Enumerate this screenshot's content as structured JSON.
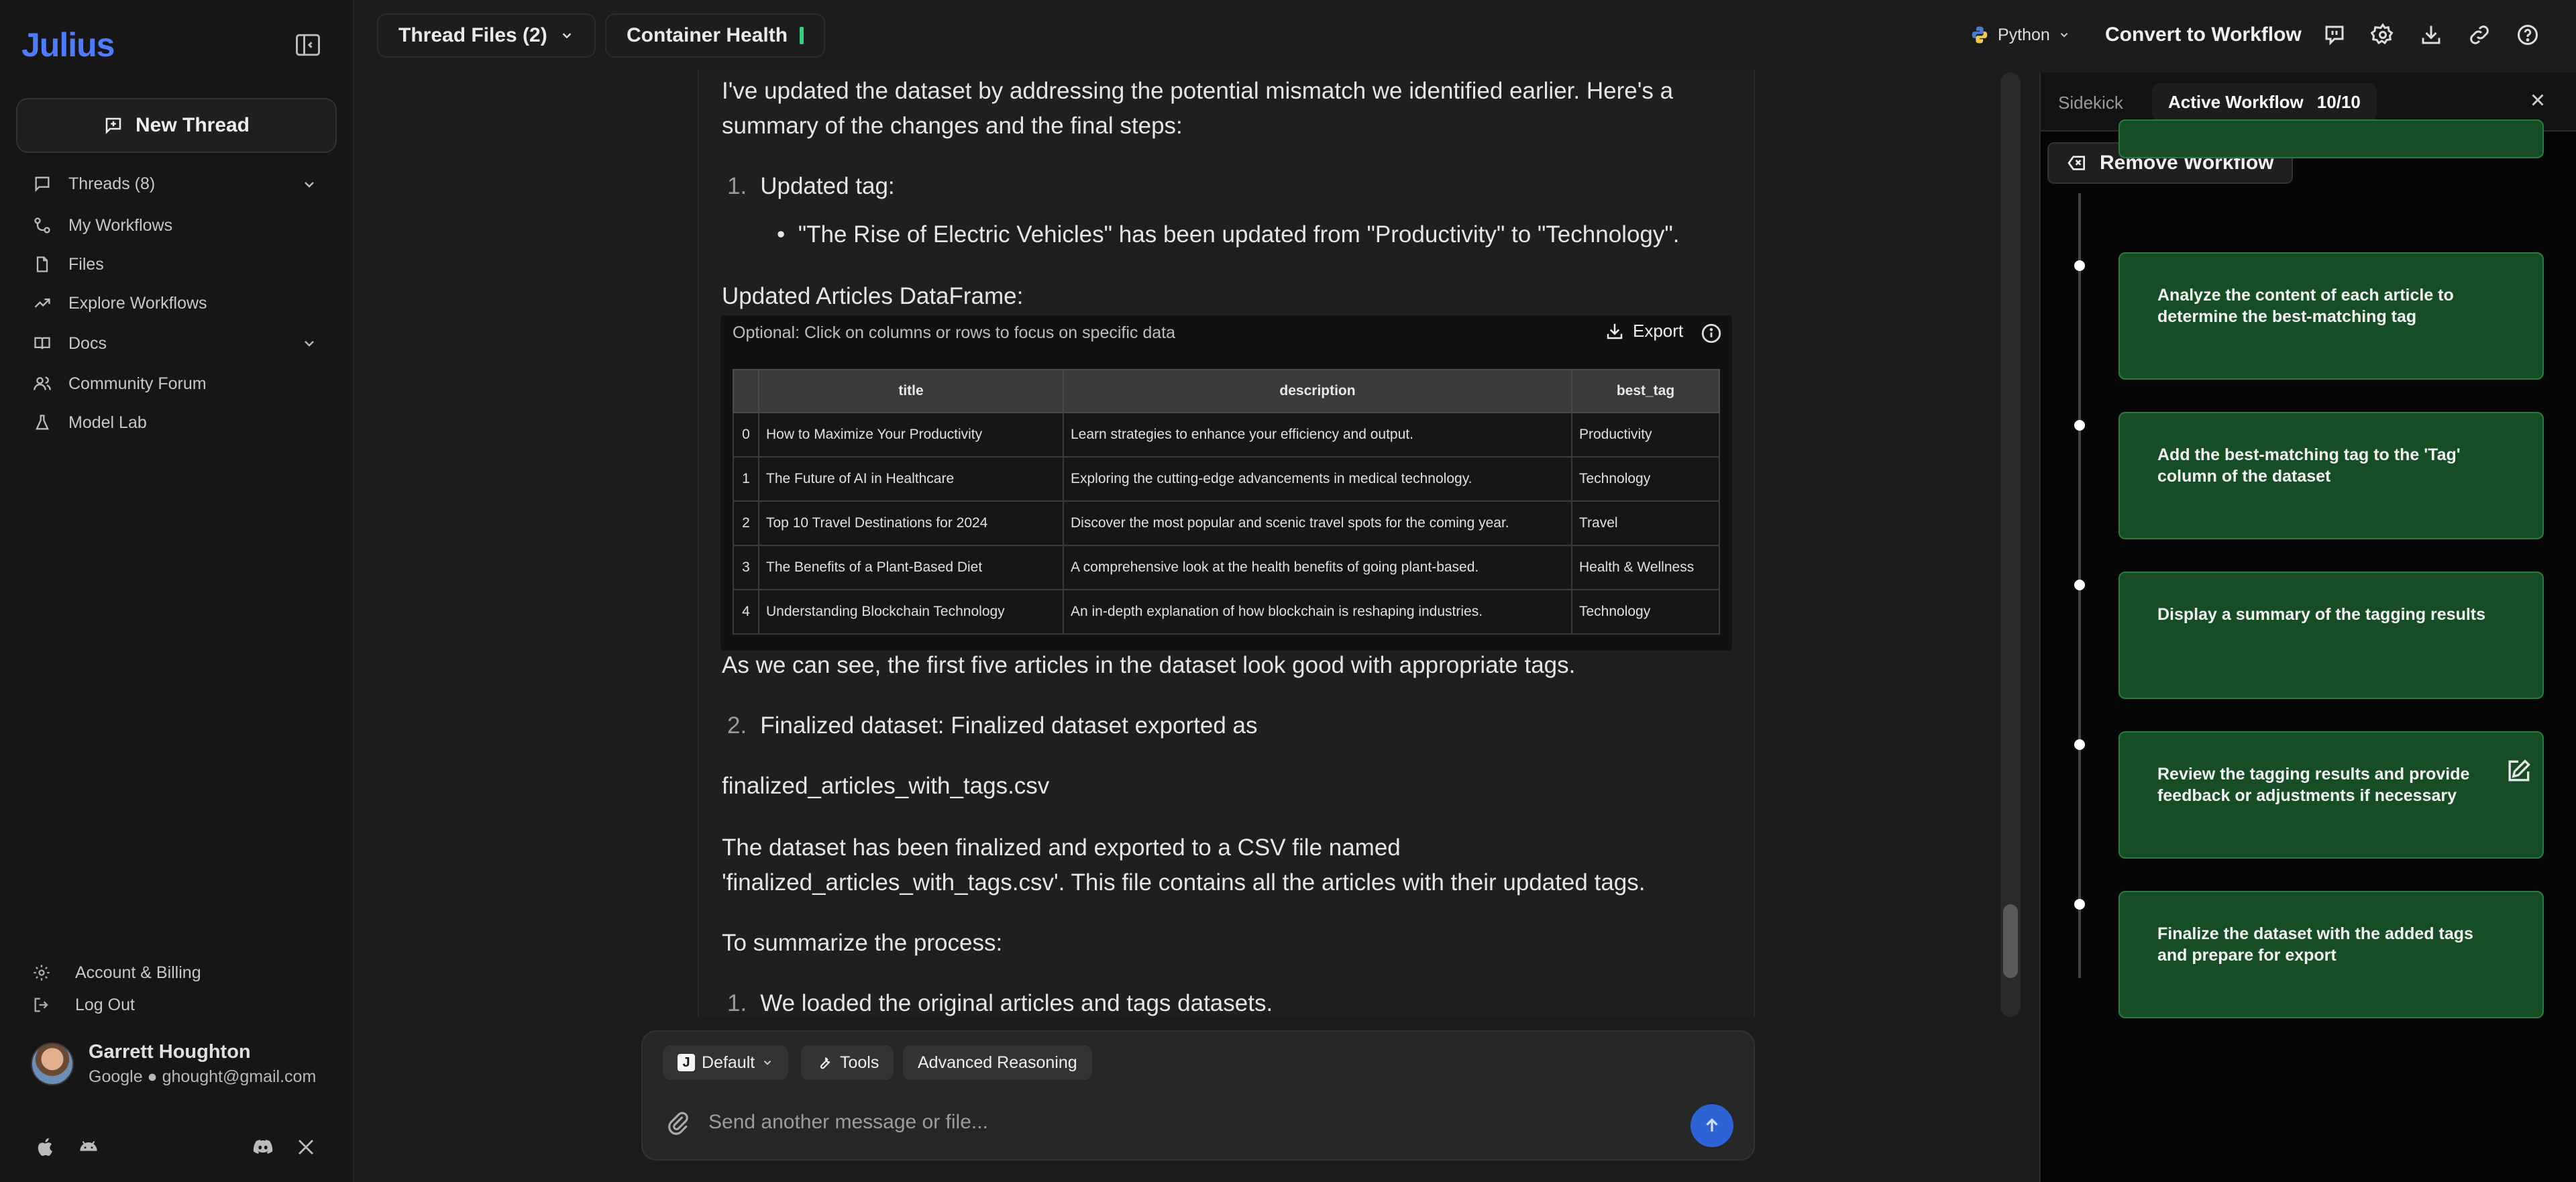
{
  "app": {
    "logo": "Julius"
  },
  "sidebar": {
    "new_thread": "New Thread",
    "items": [
      {
        "label": "Threads (8)",
        "icon": "chat-icon"
      },
      {
        "label": "My Workflows",
        "icon": "workflow-icon"
      },
      {
        "label": "Files",
        "icon": "file-icon"
      },
      {
        "label": "Explore Workflows",
        "icon": "trending-icon"
      },
      {
        "label": "Docs",
        "icon": "book-icon"
      },
      {
        "label": "Community Forum",
        "icon": "users-icon"
      },
      {
        "label": "Model Lab",
        "icon": "flask-icon"
      }
    ],
    "account_billing": "Account & Billing",
    "log_out": "Log Out",
    "user": {
      "name": "Garrett Houghton",
      "email": "Google ● ghought@gmail.com"
    }
  },
  "topbar": {
    "thread_files": "Thread Files (2)",
    "container_health": "Container Health",
    "language": "Python",
    "convert": "Convert to Workflow"
  },
  "chat": {
    "intro": "I've updated the dataset by addressing the potential mismatch we identified earlier. Here's a summary of the changes and the final steps:",
    "step1_num": "1.",
    "step1": "Updated tag:",
    "step1_bullet": "\"The Rise of Electric Vehicles\" has been updated from \"Productivity\" to \"Technology\".",
    "df_title": "Updated Articles DataFrame:",
    "df_hint": "Optional: Click on columns or rows to focus on specific data",
    "df_export": "Export",
    "columns": [
      "",
      "title",
      "description",
      "best_tag"
    ],
    "rows": [
      [
        "0",
        "How to Maximize Your Productivity",
        "Learn strategies to enhance your efficiency and output.",
        "Productivity"
      ],
      [
        "1",
        "The Future of AI in Healthcare",
        "Exploring the cutting-edge advancements in medical technology.",
        "Technology"
      ],
      [
        "2",
        "Top 10 Travel Destinations for 2024",
        "Discover the most popular and scenic travel spots for the coming year.",
        "Travel"
      ],
      [
        "3",
        "The Benefits of a Plant-Based Diet",
        "A comprehensive look at the health benefits of going plant-based.",
        "Health & Wellness"
      ],
      [
        "4",
        "Understanding Blockchain Technology",
        "An in-depth explanation of how blockchain is reshaping industries.",
        "Technology"
      ]
    ],
    "after_table": "As we can see, the first five articles in the dataset look good with appropriate tags.",
    "step2_num": "2.",
    "step2": "Finalized dataset: Finalized dataset exported as",
    "filename": "finalized_articles_with_tags.csv",
    "finalized_text": "The dataset has been finalized and exported to a CSV file named 'finalized_articles_with_tags.csv'. This file contains all the articles with their updated tags.",
    "summary_heading": "To summarize the process:",
    "summary_num": "1.",
    "summary_1": "We loaded the original articles and tags datasets."
  },
  "composer": {
    "model": "Default",
    "tools": "Tools",
    "advanced": "Advanced Reasoning",
    "placeholder": "Send another message or file..."
  },
  "sidekick": {
    "label": "Sidekick",
    "tab": "Active Workflow",
    "progress": "10/10",
    "remove": "Remove Workflow",
    "steps": [
      "Analyze the content of each article to determine the best-matching tag",
      "Add the best-matching tag to the 'Tag' column of the dataset",
      "Display a summary of the tagging results",
      "Review the tagging results and provide feedback or adjustments if necessary",
      "Finalize the dataset with the added tags and prepare for export"
    ]
  },
  "colors": {
    "accent": "#4f7bff",
    "step_bg": "#174d24",
    "health": "#35d07f",
    "send": "#2e63d6"
  }
}
